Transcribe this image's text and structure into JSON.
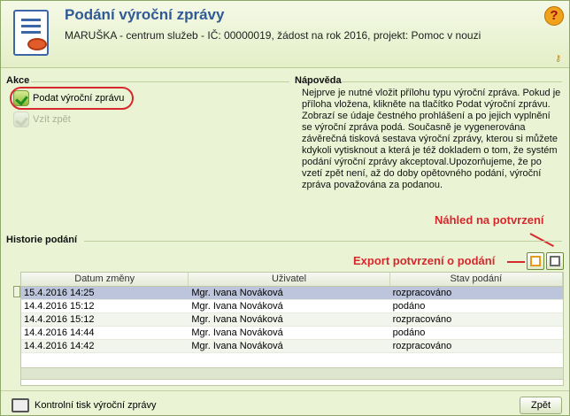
{
  "header": {
    "title": "Podání výroční zprávy",
    "subtitle": "MARUŠKA - centrum služeb - IČ: 00000019, žádost na rok 2016, projekt: Pomoc v nouzi"
  },
  "akce": {
    "label": "Akce",
    "items": [
      {
        "label": "Podat výroční zprávu",
        "enabled": true
      },
      {
        "label": "Vzít zpět",
        "enabled": false
      }
    ]
  },
  "napoveda": {
    "label": "Nápověda",
    "text": "Nejprve je nutné vložit přílohu typu výroční zpráva. Pokud je příloha vložena, klikněte na tlačítko Podat výroční zprávu. Zobrazí se údaje čestného prohlášení a po jejich vyplnění se výroční zpráva podá. Současně je vygenerována závěrečná tisková sestava výroční zprávy, kterou si můžete kdykoli vytisknout a která je též dokladem o tom, že systém podání výroční zprávy akceptoval.Upozorňujeme, že po vzetí zpět není, až do doby opětovného podání, výroční zpráva považována za podanou."
  },
  "annotations": {
    "nahled": "Náhled na potvrzení",
    "export": "Export potvrzení o podání"
  },
  "history": {
    "label": "Historie podání",
    "columns": [
      "Datum změny",
      "Uživatel",
      "Stav podání"
    ],
    "rows": [
      {
        "date": "15.4.2016 14:25",
        "user": "Mgr. Ivana Nováková",
        "status": "rozpracováno",
        "selected": true
      },
      {
        "date": "14.4.2016 15:12",
        "user": "Mgr. Ivana Nováková",
        "status": "podáno"
      },
      {
        "date": "14.4.2016 15:12",
        "user": "Mgr. Ivana Nováková",
        "status": "rozpracováno"
      },
      {
        "date": "14.4.2016 14:44",
        "user": "Mgr. Ivana Nováková",
        "status": "podáno"
      },
      {
        "date": "14.4.2016 14:42",
        "user": "Mgr. Ivana Nováková",
        "status": "rozpracováno"
      }
    ]
  },
  "footer": {
    "print_label": "Kontrolní tisk výroční zprávy",
    "back_label": "Zpět"
  },
  "colors": {
    "accent": "#2f5a96",
    "annotation": "#d7282d",
    "background": "#eaf3d4"
  }
}
